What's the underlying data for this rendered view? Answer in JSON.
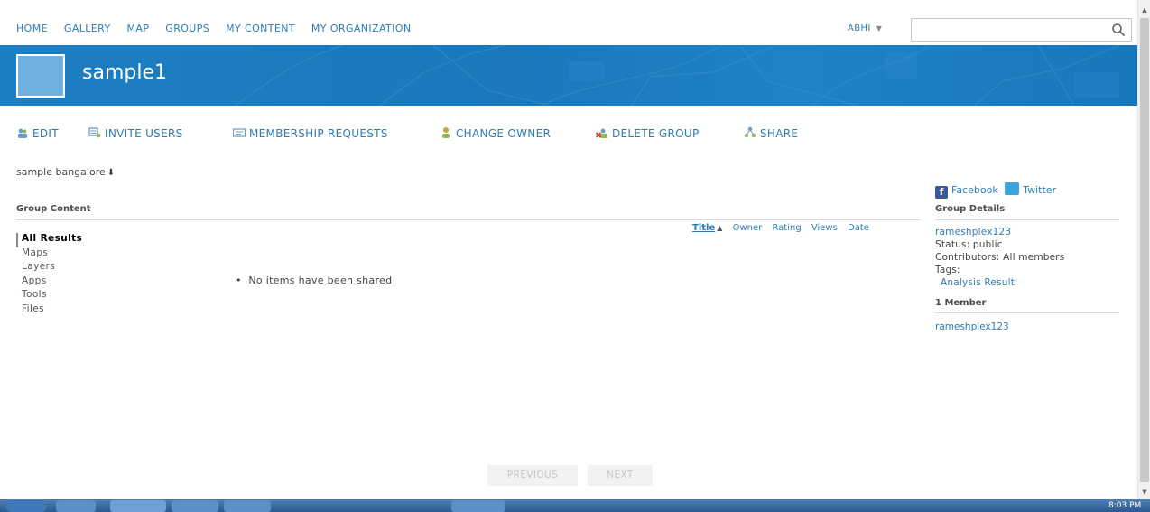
{
  "nav": {
    "links": [
      "HOME",
      "GALLERY",
      "MAP",
      "GROUPS",
      "MY CONTENT",
      "MY ORGANIZATION"
    ],
    "user": "ABHI",
    "search_value": ""
  },
  "group": {
    "title": "sample1",
    "description": "sample bangalore"
  },
  "toolbar": {
    "edit": "EDIT",
    "invite": "INVITE USERS",
    "membership": "MEMBERSHIP REQUESTS",
    "change_owner": "CHANGE OWNER",
    "delete": "DELETE GROUP",
    "share": "SHARE"
  },
  "content": {
    "heading": "Group Content",
    "sort": [
      "Title",
      "Owner",
      "Rating",
      "Views",
      "Date"
    ],
    "active_sort": "Title",
    "filters": [
      "All Results",
      "Maps",
      "Layers",
      "Apps",
      "Tools",
      "Files"
    ],
    "empty_message": "No items have been shared"
  },
  "social": {
    "facebook": "Facebook",
    "twitter": "Twitter"
  },
  "details": {
    "heading": "Group Details",
    "owner": "rameshplex123",
    "status": "Status: public",
    "contributors": "Contributors: All members",
    "tags_label": "Tags:",
    "tag": "Analysis Result",
    "members_heading": "1 Member",
    "member": "rameshplex123"
  },
  "pager": {
    "previous": "PREVIOUS",
    "next": "NEXT"
  },
  "taskbar": {
    "clock": "8:03 PM"
  },
  "colors": {
    "accent": "#2b7cb6",
    "banner": "#1a78bb"
  }
}
